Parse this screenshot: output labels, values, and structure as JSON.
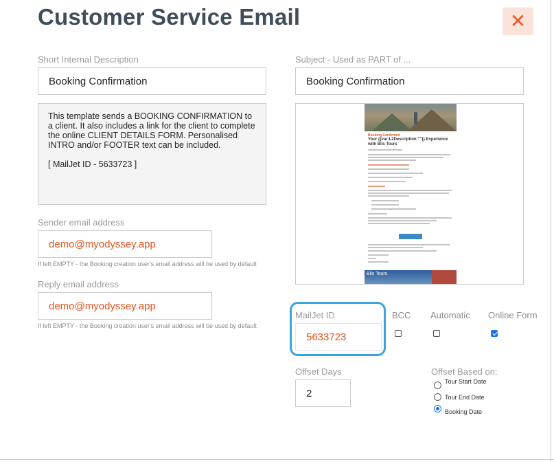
{
  "dialog": {
    "title": "Customer Service Email",
    "close_icon": "close-icon",
    "close_glyph": "✕"
  },
  "short_description": {
    "label": "Short Internal Description",
    "value": "Booking Confirmation"
  },
  "subject": {
    "label": "Subject - Used as PART of ...",
    "value": "Booking Confirmation"
  },
  "template_description": {
    "text": "This template sends a BOOKING CONFIRMATION to a client.  It also includes a link for the client to complete the online CLIENT DETAILS FORM. Personalised INTRO and/or FOOTER text can be included.",
    "mailjet_note": "[ MailJet ID - 5633723 ]"
  },
  "sender_email": {
    "label": "Sender email address",
    "value": "demo@myodyssey.app",
    "help": "If left EMPTY - the Booking creation user's email address will be used by default"
  },
  "reply_email": {
    "label": "Reply email address",
    "value": "demo@myodyssey.app",
    "help": "If left EMPTY - the Booking creation user's email address will be used by default"
  },
  "preview": {
    "heading": "Booking Confirmed",
    "subheading": "Your {{var:L2Description:\"\"}} Experience with Bils Tours",
    "button_label": "My Details",
    "footer_text": "Bils Tours"
  },
  "mailjet": {
    "label": "MailJet ID",
    "value": "5633723"
  },
  "options": {
    "bcc": {
      "label": "BCC",
      "checked": false
    },
    "automatic": {
      "label": "Automatic",
      "checked": false
    },
    "online_form": {
      "label": "Online Form",
      "checked": true
    }
  },
  "offset_days": {
    "label": "Offset Days",
    "value": "2"
  },
  "offset_based_on": {
    "label": "Offset Based on:",
    "options": [
      {
        "label": "Tour Start Date",
        "selected": false
      },
      {
        "label": "Tour End Date",
        "selected": false
      },
      {
        "label": "Booking Date",
        "selected": true
      }
    ]
  },
  "colors": {
    "accent": "#e0541f",
    "title": "#3f4e58",
    "focus": "#3aa4e0",
    "checkbox": "#1a73e8"
  }
}
